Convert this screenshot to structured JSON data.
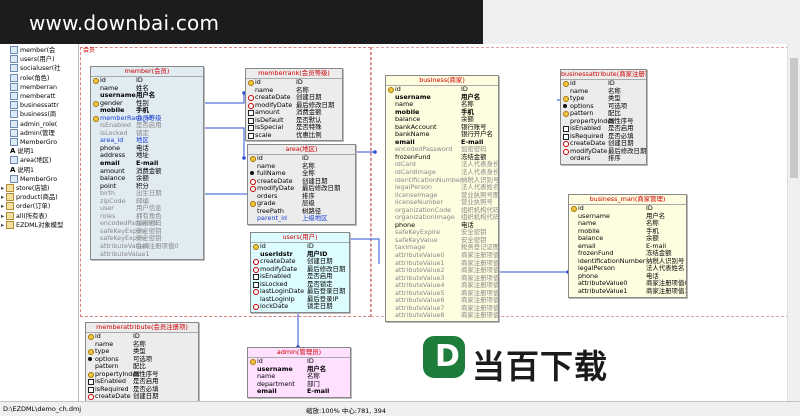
{
  "watermark": {
    "text": "www.downbai.com"
  },
  "logo": {
    "letter": "D",
    "text": "当百下载",
    "color": "#1e7d3a"
  },
  "tree": {
    "items": [
      {
        "label": "member(会",
        "icon": "table-icon",
        "indent": 1
      },
      {
        "label": "users(用户)",
        "icon": "table-icon",
        "indent": 1
      },
      {
        "label": "socialuser(社",
        "icon": "table-icon",
        "indent": 1
      },
      {
        "label": "role(角色)",
        "icon": "table-icon",
        "indent": 1
      },
      {
        "label": "memberran",
        "icon": "table-icon",
        "indent": 1
      },
      {
        "label": "memberatt",
        "icon": "table-icon",
        "indent": 1
      },
      {
        "label": "businessattr",
        "icon": "table-icon",
        "indent": 1
      },
      {
        "label": "business(商",
        "icon": "table-icon",
        "indent": 1
      },
      {
        "label": "admin_role(",
        "icon": "table-icon",
        "indent": 1
      },
      {
        "label": "admin(管理",
        "icon": "table-icon",
        "indent": 1
      },
      {
        "label": "MemberGro",
        "icon": "table-icon",
        "indent": 1
      },
      {
        "label": "说明1",
        "icon": "text-icon",
        "indent": 1
      },
      {
        "label": "area(地区)",
        "icon": "table-icon",
        "indent": 1
      },
      {
        "label": "说明1",
        "icon": "text-icon",
        "indent": 1
      },
      {
        "label": "MemberGro",
        "icon": "table-icon",
        "indent": 1
      },
      {
        "label": "store(店铺)",
        "icon": "folder-icon",
        "indent": 0
      },
      {
        "label": "product(商品)",
        "icon": "folder-icon",
        "indent": 0
      },
      {
        "label": "order(订单)",
        "icon": "folder-icon",
        "indent": 0
      },
      {
        "label": "all(所有表)",
        "icon": "folder-icon",
        "indent": 0
      },
      {
        "label": "EZDML对象模型",
        "icon": "folder-icon",
        "indent": 0
      }
    ]
  },
  "status": {
    "path": "D:\\EZDML\\demo_ch.dmj",
    "zoom": "缩放:100% 中心:781, 394"
  },
  "diagram": {
    "group_label": "会员",
    "entities": {
      "member": {
        "title": "member(会员)",
        "bg": "#e1ebf2",
        "rows": [
          {
            "f": "id",
            "l": "ID",
            "ic": "key"
          },
          {
            "f": "name",
            "l": "姓名",
            "ic": "noic"
          },
          {
            "f": "username",
            "l": "用户名",
            "ic": "noic",
            "b": true
          },
          {
            "f": "gender",
            "l": "性别",
            "ic": "key"
          },
          {
            "f": "mobile",
            "l": "手机",
            "ic": "noic",
            "b": true
          },
          {
            "f": "memberRank_id",
            "l": "会员等级",
            "ic": "key",
            "fk": true
          },
          {
            "f": "isEnabled",
            "l": "是否启用",
            "ic": "noic",
            "m": true
          },
          {
            "f": "isLocked",
            "l": "锁定",
            "ic": "noic",
            "m": true
          },
          {
            "f": "area_id",
            "l": "地区",
            "ic": "noic",
            "fk": true
          },
          {
            "f": "phone",
            "l": "电话",
            "ic": "noic"
          },
          {
            "f": "address",
            "l": "地址",
            "ic": "noic"
          },
          {
            "f": "email",
            "l": "E-mail",
            "ic": "noic",
            "b": true
          },
          {
            "f": "amount",
            "l": "消费金额",
            "ic": "noic"
          },
          {
            "f": "balance",
            "l": "余额",
            "ic": "noic"
          },
          {
            "f": "point",
            "l": "积分",
            "ic": "noic"
          },
          {
            "f": "birth",
            "l": "出生日期",
            "ic": "noic",
            "m": true
          },
          {
            "f": "zipCode",
            "l": "邮编",
            "ic": "noic",
            "m": true
          },
          {
            "f": "user",
            "l": "用户信息",
            "ic": "noic",
            "m": true
          },
          {
            "f": "roles",
            "l": "拥有角色",
            "ic": "noic",
            "m": true
          },
          {
            "f": "encodedPassword",
            "l": "加密密码",
            "ic": "noic",
            "m": true
          },
          {
            "f": "safeKeyExpire",
            "l": "安全密钥",
            "ic": "noic",
            "m": true
          },
          {
            "f": "safeKeyExpire",
            "l": "安全密钥",
            "ic": "noic",
            "m": true
          },
          {
            "f": "attributeValue0",
            "l": "会员注册项值0",
            "ic": "noic",
            "m": true
          },
          {
            "f": "attributeValue1",
            "l": "...",
            "ic": "noic",
            "m": true
          }
        ]
      },
      "memberrank": {
        "title": "memberrank(会员等级)",
        "bg": "#ececec",
        "rows": [
          {
            "f": "id",
            "l": "ID",
            "ic": "key"
          },
          {
            "f": "name",
            "l": "名称",
            "ic": "noic"
          },
          {
            "f": "createDate",
            "l": "创建日期",
            "ic": "clk"
          },
          {
            "f": "modifyDate",
            "l": "最后修改日期",
            "ic": "clk"
          },
          {
            "f": "amount",
            "l": "消费金额",
            "ic": "chk"
          },
          {
            "f": "isDefault",
            "l": "是否默认",
            "ic": "chk"
          },
          {
            "f": "isSpecial",
            "l": "是否特殊",
            "ic": "chk"
          },
          {
            "f": "scale",
            "l": "优惠比例",
            "ic": "chk"
          }
        ]
      },
      "area": {
        "title": "area(地区)",
        "bg": "#ececec",
        "rows": [
          {
            "f": "id",
            "l": "ID",
            "ic": "key"
          },
          {
            "f": "name",
            "l": "名称",
            "ic": "noic"
          },
          {
            "f": "fullName",
            "l": "全称",
            "ic": "dot"
          },
          {
            "f": "createDate",
            "l": "创建日期",
            "ic": "clk"
          },
          {
            "f": "modifyDate",
            "l": "最后修改日期",
            "ic": "clk"
          },
          {
            "f": "orders",
            "l": "排序",
            "ic": "noic"
          },
          {
            "f": "grade",
            "l": "层级",
            "ic": "key"
          },
          {
            "f": "treePath",
            "l": "树路径",
            "ic": "noic"
          },
          {
            "f": "parent_id",
            "l": "上级地区",
            "ic": "noic",
            "fk": true
          }
        ]
      },
      "users": {
        "title": "users(用户)",
        "bg": "#dcfcff",
        "rows": [
          {
            "f": "id",
            "l": "ID",
            "ic": "key"
          },
          {
            "f": "userIdstr",
            "l": "用户ID",
            "ic": "noic",
            "b": true
          },
          {
            "f": "createDate",
            "l": "创建日期",
            "ic": "clk"
          },
          {
            "f": "modifyDate",
            "l": "最后修改日期",
            "ic": "clk"
          },
          {
            "f": "isEnabled",
            "l": "是否启用",
            "ic": "chk"
          },
          {
            "f": "isLocked",
            "l": "是否锁定",
            "ic": "chk"
          },
          {
            "f": "lastLoginDate",
            "l": "最后登录日期",
            "ic": "clk"
          },
          {
            "f": "lastLoginIp",
            "l": "最后登录IP",
            "ic": "noic"
          },
          {
            "f": "lockDate",
            "l": "锁定日期",
            "ic": "clk"
          }
        ]
      },
      "business": {
        "title": "business(商家)",
        "bg": "#fffde0",
        "rows": [
          {
            "f": "id",
            "l": "ID",
            "ic": "key"
          },
          {
            "f": "username",
            "l": "用户名",
            "ic": "noic",
            "b": true
          },
          {
            "f": "name",
            "l": "名称",
            "ic": "noic"
          },
          {
            "f": "mobile",
            "l": "手机",
            "ic": "noic",
            "b": true
          },
          {
            "f": "balance",
            "l": "余额",
            "ic": "noic"
          },
          {
            "f": "bankAccount",
            "l": "银行账号",
            "ic": "noic"
          },
          {
            "f": "bankName",
            "l": "银行开户名",
            "ic": "noic"
          },
          {
            "f": "email",
            "l": "E-mail",
            "ic": "noic",
            "b": true
          },
          {
            "f": "encodedPassword",
            "l": "加密密码",
            "ic": "noic",
            "m": true
          },
          {
            "f": "frozenFund",
            "l": "冻结金额",
            "ic": "noic"
          },
          {
            "f": "idCard",
            "l": "法人代表身份证",
            "ic": "noic",
            "m": true
          },
          {
            "f": "idCardImage",
            "l": "法人代表身份证图片",
            "ic": "noic",
            "m": true
          },
          {
            "f": "identificationNumber",
            "l": "纳税人识别号",
            "ic": "noic",
            "m": true
          },
          {
            "f": "legalPerson",
            "l": "法人代表姓名",
            "ic": "noic",
            "m": true
          },
          {
            "f": "licenseImage",
            "l": "营业执照号图片",
            "ic": "noic",
            "m": true
          },
          {
            "f": "licenseNumber",
            "l": "营业执照号",
            "ic": "noic",
            "m": true
          },
          {
            "f": "organizationCode",
            "l": "组织机构代码",
            "ic": "noic",
            "m": true
          },
          {
            "f": "organizationImage",
            "l": "组织机构代码证图片",
            "ic": "noic",
            "m": true
          },
          {
            "f": "phone",
            "l": "电话",
            "ic": "noic"
          },
          {
            "f": "safeKeyExpire",
            "l": "安全密钥",
            "ic": "noic",
            "m": true
          },
          {
            "f": "safeKeyValue",
            "l": "安全密钥",
            "ic": "noic",
            "m": true
          },
          {
            "f": "taxImage",
            "l": "税务登记证图片",
            "ic": "noic",
            "m": true
          },
          {
            "f": "attributeValue0",
            "l": "商家注册项值0",
            "ic": "noic",
            "m": true
          },
          {
            "f": "attributeValue1",
            "l": "商家注册项值1",
            "ic": "noic",
            "m": true
          },
          {
            "f": "attributeValue2",
            "l": "商家注册项值2",
            "ic": "noic",
            "m": true
          },
          {
            "f": "attributeValue3",
            "l": "商家注册项值3",
            "ic": "noic",
            "m": true
          },
          {
            "f": "attributeValue4",
            "l": "商家注册项值4",
            "ic": "noic",
            "m": true
          },
          {
            "f": "attributeValue5",
            "l": "商家注册项值5",
            "ic": "noic",
            "m": true
          },
          {
            "f": "attributeValue6",
            "l": "商家注册项值6",
            "ic": "noic",
            "m": true
          },
          {
            "f": "attributeValue7",
            "l": "商家注册项值7",
            "ic": "noic",
            "m": true
          },
          {
            "f": "attributeValue8",
            "l": "商家注册项值8",
            "ic": "noic",
            "m": true
          }
        ]
      },
      "businessattribute": {
        "title": "businessattribute(商家注册项)",
        "bg": "#ececec",
        "rows": [
          {
            "f": "id",
            "l": "ID",
            "ic": "key"
          },
          {
            "f": "name",
            "l": "名称",
            "ic": "noic"
          },
          {
            "f": "type",
            "l": "类型",
            "ic": "key"
          },
          {
            "f": "options",
            "l": "可选项",
            "ic": "dot"
          },
          {
            "f": "pattern",
            "l": "配比",
            "ic": "key"
          },
          {
            "f": "propertyIndex",
            "l": "属性序号",
            "ic": "noic"
          },
          {
            "f": "isEnabled",
            "l": "是否启用",
            "ic": "chk"
          },
          {
            "f": "isRequired",
            "l": "是否必填",
            "ic": "chk"
          },
          {
            "f": "createDate",
            "l": "创建日期",
            "ic": "clk"
          },
          {
            "f": "modifyDate",
            "l": "最后修改日期",
            "ic": "clk"
          },
          {
            "f": "orders",
            "l": "排序",
            "ic": "noic"
          }
        ]
      },
      "business_man": {
        "title": "business_man(商家管理)",
        "bg": "#fffde0",
        "rows": [
          {
            "f": "id",
            "l": "ID",
            "ic": "key"
          },
          {
            "f": "username",
            "l": "用户名",
            "ic": "noic"
          },
          {
            "f": "name",
            "l": "名称",
            "ic": "noic"
          },
          {
            "f": "mobile",
            "l": "手机",
            "ic": "noic"
          },
          {
            "f": "balance",
            "l": "余额",
            "ic": "noic"
          },
          {
            "f": "email",
            "l": "E-mail",
            "ic": "noic"
          },
          {
            "f": "frozenFund",
            "l": "冻结金额",
            "ic": "noic"
          },
          {
            "f": "identificationNumber",
            "l": "纳税人识别号",
            "ic": "noic"
          },
          {
            "f": "legalPerson",
            "l": "法人代表姓名",
            "ic": "noic"
          },
          {
            "f": "phone",
            "l": "电话",
            "ic": "noic"
          },
          {
            "f": "attributeValue0",
            "l": "商家注册项值0",
            "ic": "noic"
          },
          {
            "f": "attributeValue1",
            "l": "商家注册项值1",
            "ic": "noic"
          }
        ]
      },
      "memberattribute": {
        "title": "memberattribute(会员注册项)",
        "bg": "#ececec",
        "rows": [
          {
            "f": "id",
            "l": "ID",
            "ic": "key"
          },
          {
            "f": "name",
            "l": "名称",
            "ic": "noic"
          },
          {
            "f": "type",
            "l": "类型",
            "ic": "key"
          },
          {
            "f": "options",
            "l": "可选项",
            "ic": "dot"
          },
          {
            "f": "pattern",
            "l": "配比",
            "ic": "noic"
          },
          {
            "f": "propertyIndex",
            "l": "属性序号",
            "ic": "key"
          },
          {
            "f": "isEnabled",
            "l": "是否启用",
            "ic": "chk"
          },
          {
            "f": "isRequired",
            "l": "是否必填",
            "ic": "chk"
          },
          {
            "f": "createDate",
            "l": "创建日期",
            "ic": "clk"
          }
        ]
      },
      "admin": {
        "title": "admin(管理员)",
        "bg": "#ffe0ff",
        "rows": [
          {
            "f": "id",
            "l": "ID",
            "ic": "key"
          },
          {
            "f": "username",
            "l": "用户名",
            "ic": "noic",
            "b": true
          },
          {
            "f": "name",
            "l": "名称",
            "ic": "noic"
          },
          {
            "f": "department",
            "l": "部门",
            "ic": "noic"
          },
          {
            "f": "email",
            "l": "E-mail",
            "ic": "noic",
            "b": true
          }
        ]
      }
    }
  }
}
